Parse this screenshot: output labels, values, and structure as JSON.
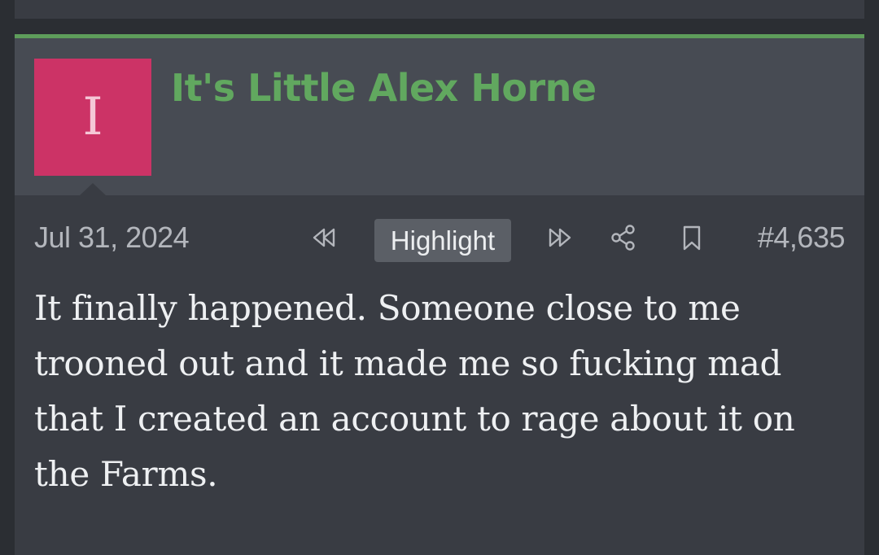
{
  "post": {
    "avatar_letter": "I",
    "username": "It's Little Alex Horne",
    "date": "Jul 31, 2024",
    "highlight_label": "Highlight",
    "post_number": "#4,635",
    "body": "It finally happened. Someone close to me trooned out and it made me so fucking mad that I created an account to rage about it on the Farms."
  },
  "icons": {
    "prev": "rewind-icon",
    "next": "fast-forward-icon",
    "share": "share-icon",
    "bookmark": "bookmark-icon"
  },
  "colors": {
    "accent": "#5e9d5b",
    "username": "#61a85f",
    "avatar_bg": "#cc3366",
    "background": "#393c43",
    "header_bg": "#474b53"
  }
}
